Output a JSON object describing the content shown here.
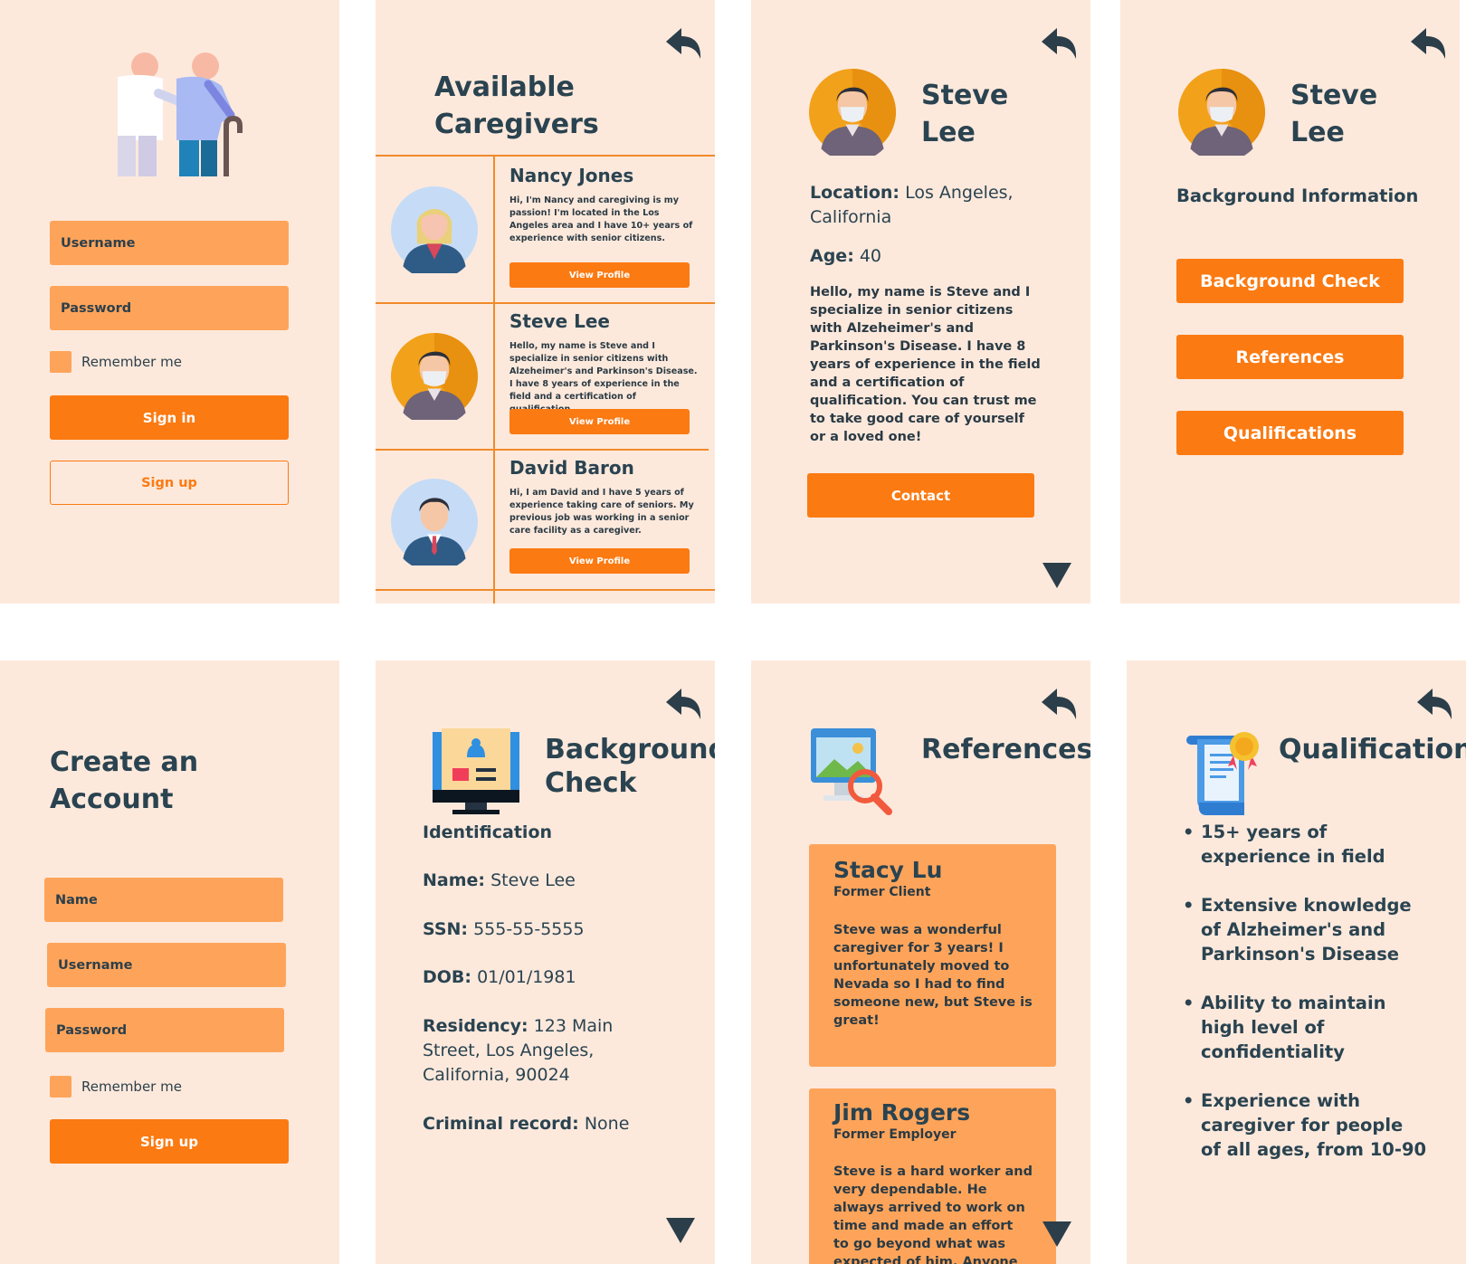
{
  "login": {
    "username_placeholder": "Username",
    "password_placeholder": "Password",
    "remember_label": "Remember me",
    "signin_label": "Sign in",
    "signup_label": "Sign up"
  },
  "caregivers": {
    "title_line1": "Available",
    "title_line2": "Caregivers",
    "view_profile_label": "View Profile",
    "items": [
      {
        "name": "Nancy Jones",
        "desc": "Hi, I'm Nancy and caregiving is my passion! I'm located in the Los Angeles area and I have 10+ years of experience with senior citizens."
      },
      {
        "name": "Steve Lee",
        "desc": "Hello, my name is Steve and I specialize in senior citizens with Alzeheimer's and Parkinson's Disease. I have 8 years of experience in the field and a certification of qualification."
      },
      {
        "name": "David Baron",
        "desc": "Hi, I am David and I have 5 years of experience taking care of seniors. My previous job was working in a senior care facility as a caregiver."
      }
    ]
  },
  "profile": {
    "first_name": "Steve",
    "last_name": "Lee",
    "location_label": "Location:",
    "location_value": "Los Angeles, California",
    "age_label": "Age:",
    "age_value": "40",
    "bio": "Hello, my name is Steve and I specialize in senior citizens with Alzeheimer's and Parkinson's Disease. I have 8 years of experience in the field and a certification of qualification. You can trust me to take good care of yourself or a loved one!",
    "contact_label": "Contact"
  },
  "background_menu": {
    "first_name": "Steve",
    "last_name": "Lee",
    "heading": "Background Information",
    "buttons": [
      "Background Check",
      "References",
      "Qualifications"
    ]
  },
  "create_account": {
    "title_line1": "Create an",
    "title_line2": "Account",
    "name_placeholder": "Name",
    "username_placeholder": "Username",
    "password_placeholder": "Password",
    "remember_label": "Remember me",
    "signup_label": "Sign up"
  },
  "background_check": {
    "title_line1": "Background",
    "title_line2": "Check",
    "section": "Identification",
    "name_label": "Name:",
    "name_value": "Steve Lee",
    "ssn_label": "SSN:",
    "ssn_value": "555-55-5555",
    "dob_label": "DOB:",
    "dob_value": "01/01/1981",
    "residency_label": "Residency:",
    "residency_value": "123 Main Street, Los Angeles, California, 90024",
    "criminal_label": "Criminal record:",
    "criminal_value": "None"
  },
  "references": {
    "title": "References",
    "items": [
      {
        "name": "Stacy Lu",
        "role": "Former Client",
        "text": "Steve was a wonderful caregiver for 3 years! I unfortunately moved to Nevada so I had to find someone new, but Steve is great!"
      },
      {
        "name": "Jim Rogers",
        "role": "Former Employer",
        "text": "Steve is a hard worker and very dependable. He always arrived to work on time and made an effort to go beyond what was expected of him. Anyone would be"
      }
    ]
  },
  "qualifications": {
    "title": "Qualifications",
    "items": [
      "15+ years of experience in field",
      "Extensive knowledge of Alzheimer's and Parkinson's Disease",
      "Ability to maintain high level of confidentiality",
      "Experience with caregiver for people of all ages, from 10-90"
    ]
  },
  "colors": {
    "panel_bg": "#fde9dc",
    "accent": "#fb7a12",
    "field": "#fea45a",
    "text": "#2a4350"
  }
}
